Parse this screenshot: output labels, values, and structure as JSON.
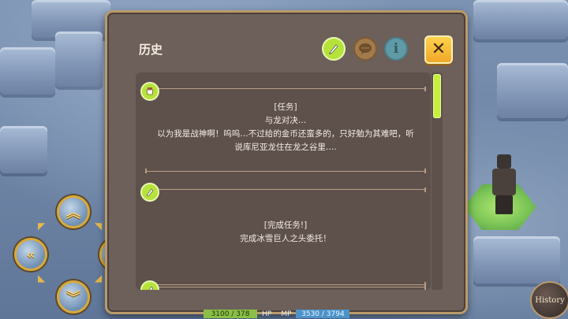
{
  "panel": {
    "title": "历史",
    "tabs": [
      {
        "icon": "quill-icon",
        "active": true
      },
      {
        "icon": "speech-bubble-icon",
        "active": false
      },
      {
        "icon": "info-icon",
        "label": "i",
        "active": false
      }
    ],
    "close_label": "✕"
  },
  "entries": [
    {
      "icon": "quest-stamp-icon",
      "lines": [
        "[任务]",
        "与龙对决…",
        "以为我是战神啊！呜呜…不过给的金币还蛮多的，只好勉为其难吧，听",
        "说库尼亚龙住在龙之谷里…."
      ]
    },
    {
      "icon": "quill-icon",
      "lines": [
        "[完成任务!]",
        "完成冰雪巨人之头委托！"
      ]
    },
    {
      "icon": "quill-icon",
      "lines": []
    }
  ],
  "hud": {
    "hp_value": "3100 / 378",
    "hp_label": "HP",
    "mp_label": "MP",
    "mp_value": "3530 / 3794"
  },
  "history_button_label": "History",
  "colors": {
    "panel_bg": "#6d5f59",
    "accent_green": "#b6e33b",
    "close_orange": "#f0a82a"
  }
}
